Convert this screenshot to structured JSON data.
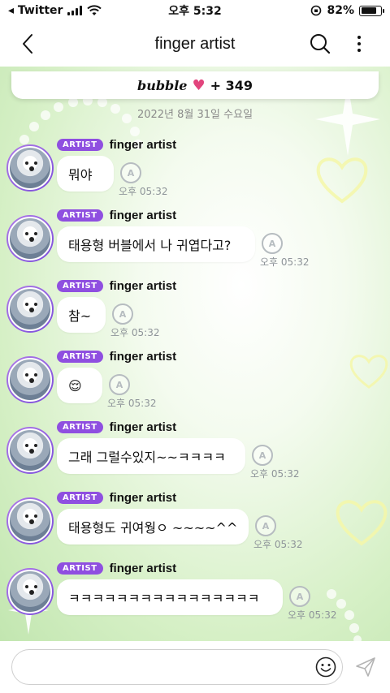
{
  "status_bar": {
    "carrier": "◂ Twitter",
    "time": "오후 5:32",
    "battery": "82%",
    "battery_level": 0.82
  },
  "header": {
    "title": "finger artist",
    "back_icon": "chevron-left-icon",
    "search_icon": "search-icon",
    "more_icon": "more-vertical-icon"
  },
  "banner": {
    "brand": "bubble",
    "count": "+ 349"
  },
  "date_separator": "2022년 8월 31일 수요일",
  "messages": [
    {
      "badge": "ARTIST",
      "sender": "finger artist",
      "text": "뭐야",
      "time": "오후 05:32"
    },
    {
      "badge": "ARTIST",
      "sender": "finger artist",
      "text": "태용형 버블에서 나 귀엽다고?",
      "time": "오후 05:32"
    },
    {
      "badge": "ARTIST",
      "sender": "finger artist",
      "text": "참~",
      "time": "오후 05:32"
    },
    {
      "badge": "ARTIST",
      "sender": "finger artist",
      "text": "😌",
      "time": "오후 05:32"
    },
    {
      "badge": "ARTIST",
      "sender": "finger artist",
      "text": "그래 그럴수있지~~ㅋㅋㅋㅋ",
      "time": "오후 05:32"
    },
    {
      "badge": "ARTIST",
      "sender": "finger artist",
      "text": "태용형도 귀여웡ㅇ ~~~~^^",
      "time": "오후 05:32"
    },
    {
      "badge": "ARTIST",
      "sender": "finger artist",
      "text": "ㅋㅋㅋㅋㅋㅋㅋㅋㅋㅋㅋㅋㅋㅋㅋㅋ",
      "time": "오후 05:32"
    }
  ],
  "input": {
    "placeholder": "",
    "value": "",
    "emoji_icon": "smiley-icon",
    "send_icon": "send-icon"
  },
  "colors": {
    "artist_badge": "#8f4fe0",
    "heart": "#e2457d",
    "background_green": "#c2e6b0"
  }
}
